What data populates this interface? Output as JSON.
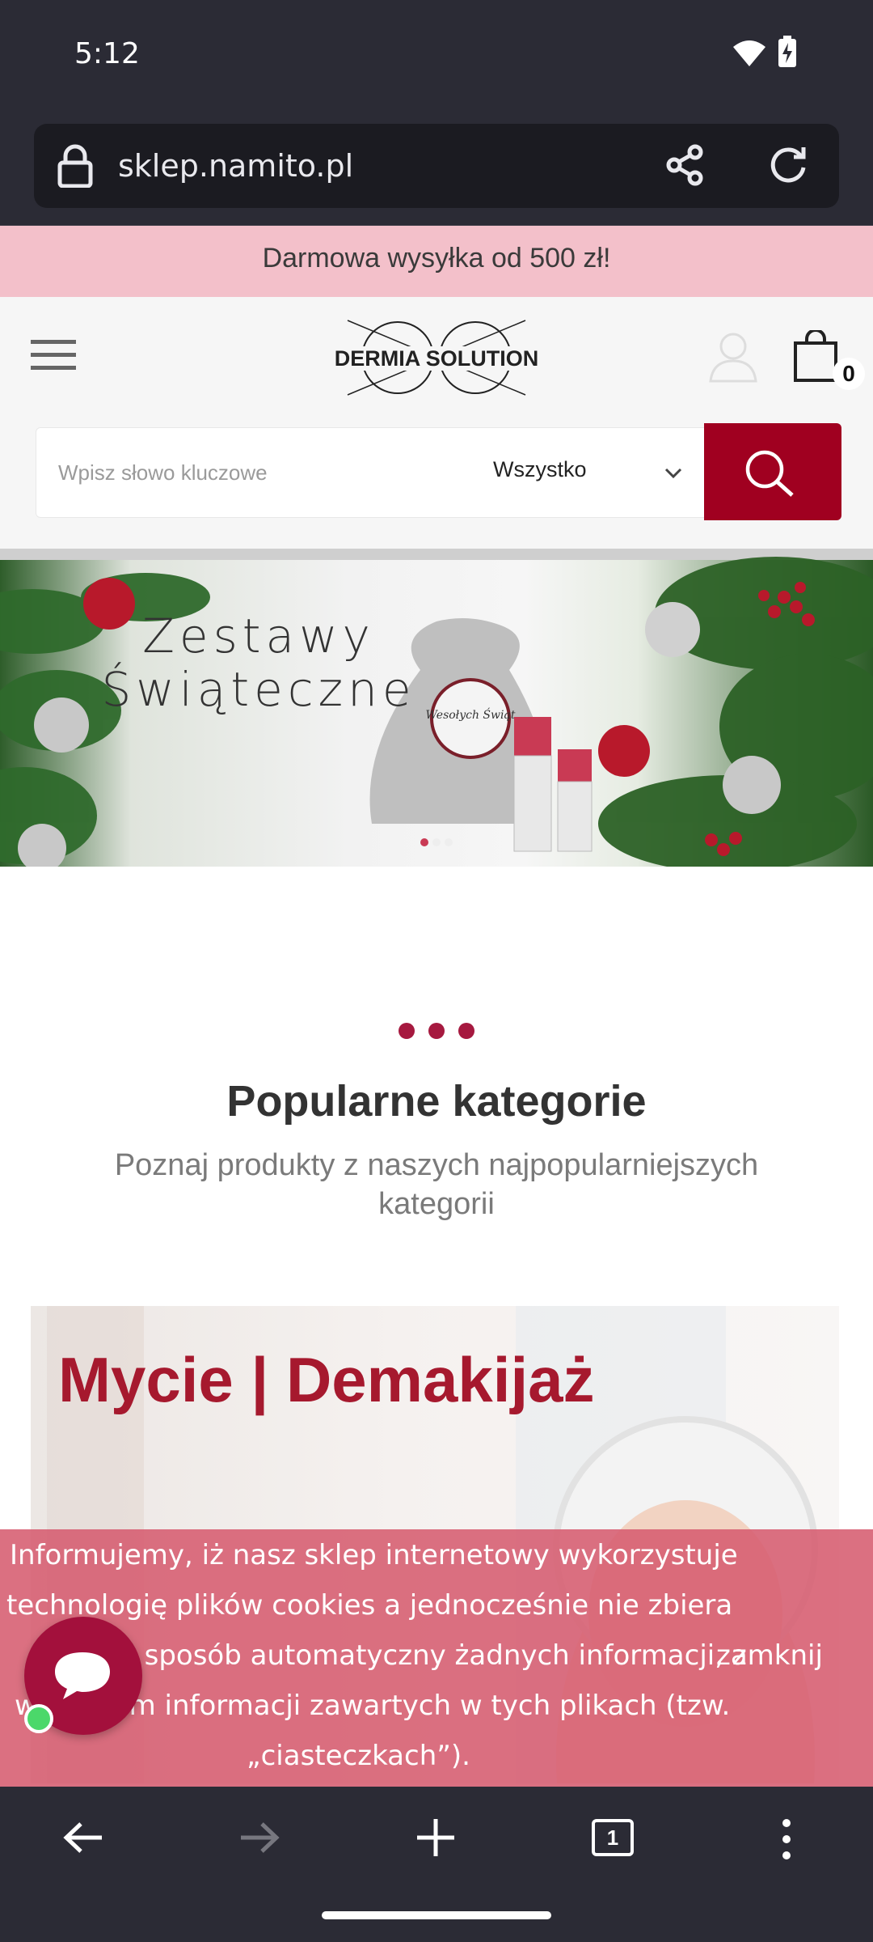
{
  "status_bar": {
    "time": "5:12"
  },
  "browser": {
    "url": "sklep.namito.pl",
    "tab_count": "1"
  },
  "promo": {
    "text": "Darmowa wysyłka od 500 zł!"
  },
  "header": {
    "logo_text": "DERMIA SOLUTION",
    "cart_count": "0"
  },
  "search": {
    "placeholder": "Wpisz słowo kluczowe",
    "category": "Wszystko"
  },
  "banner": {
    "title_line1": "Zestawy",
    "title_line2": "Świąteczne",
    "bag_text": "Wesołych Świąt"
  },
  "section": {
    "title": "Popularne kategorie",
    "subtitle": "Poznaj produkty z naszych najpopularniejszych kategorii"
  },
  "category_card": {
    "title": "Mycie | Demakijaż"
  },
  "cookie": {
    "lines": [
      "Informujemy, iż nasz sklep internetowy wykorzystuje",
      "technologię plików cookies a jednocześnie nie zbiera",
      "w sposób automatyczny żadnych informacji, z",
      "wyjątkiem informacji zawartych w tych plikach (tzw.",
      "„ciasteczkach”)."
    ],
    "close_label": "zamknij"
  },
  "colors": {
    "accent": "#a00020",
    "promo_bg": "#f3c0ca",
    "cookie_bg": "#d65c70"
  }
}
